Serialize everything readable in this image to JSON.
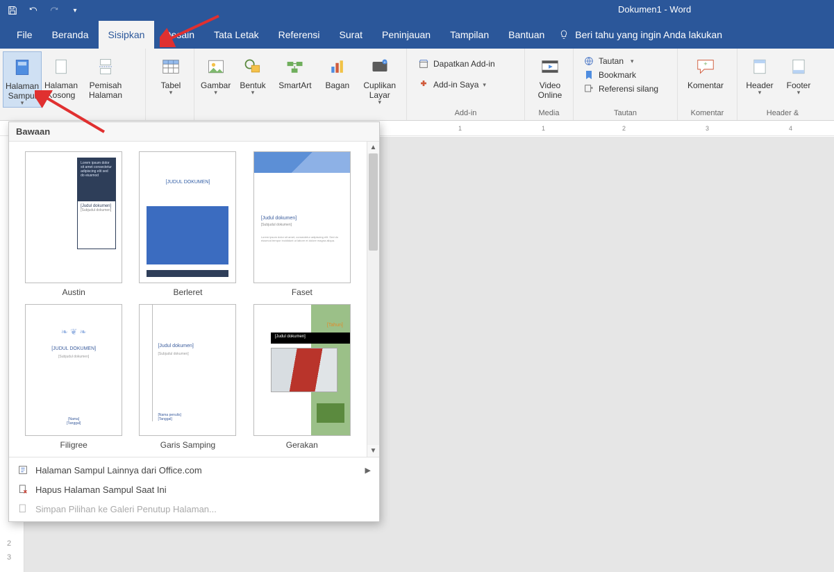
{
  "title": "Dokumen1  -  Word",
  "qat": {
    "save": "Save",
    "undo": "Undo",
    "redo": "Redo",
    "customize": "Customize"
  },
  "tabs": {
    "file": "File",
    "beranda": "Beranda",
    "sisipkan": "Sisipkan",
    "desain": "Desain",
    "tataletak": "Tata Letak",
    "referensi": "Referensi",
    "surat": "Surat",
    "peninjauan": "Peninjauan",
    "tampilan": "Tampilan",
    "bantuan": "Bantuan",
    "tellme": "Beri tahu yang ingin Anda lakukan"
  },
  "ribbon": {
    "halaman_sampul": "Halaman Sampul",
    "halaman_kosong": "Halaman Kosong",
    "pemisah_halaman": "Pemisah Halaman",
    "tabel": "Tabel",
    "gambar": "Gambar",
    "bentuk": "Bentuk",
    "smartart": "SmartArt",
    "bagan": "Bagan",
    "cuplikan_layar": "Cuplikan Layar",
    "dapatkan_addin": "Dapatkan Add-in",
    "addin_saya": "Add-in Saya",
    "video_online": "Video Online",
    "tautan": "Tautan",
    "bookmark": "Bookmark",
    "referensi_silang": "Referensi silang",
    "komentar": "Komentar",
    "header": "Header",
    "footer": "Footer",
    "group_addin": "Add-in",
    "group_media": "Media",
    "group_tautan": "Tautan",
    "group_komentar": "Komentar",
    "group_headerfooter": "Header & "
  },
  "gallery": {
    "header": "Bawaan",
    "austin": "Austin",
    "berleret": "Berleret",
    "faset": "Faset",
    "filigree": "Filigree",
    "garis": "Garis Samping",
    "gerakan": "Gerakan",
    "thumb_judul": "[Judul dokumen]",
    "thumb_judul_caps": "[JUDUL DOKUMEN]",
    "thumb_tahun": "[Tahun]",
    "thumb_sub": "[Subjudul dokumen]",
    "more": "Halaman Sampul Lainnya dari Office.com",
    "remove": "Hapus Halaman Sampul Saat Ini",
    "save_sel": "Simpan Pilihan ke Galeri Penutup Halaman..."
  },
  "ruler": {
    "n1": "1",
    "n2": "2",
    "n3": "3",
    "n4": "4"
  },
  "gutter": {
    "a": "2",
    "b": "3"
  }
}
